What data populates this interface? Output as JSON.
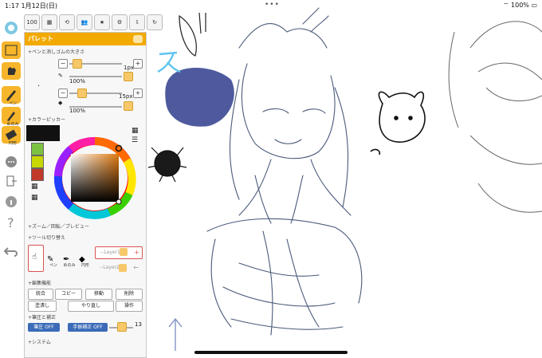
{
  "status_bar": {
    "time": "1:17",
    "date": "1月12日(日)",
    "dots": "•••",
    "battery": "100%"
  },
  "toolbar": {
    "zoom_label": "100",
    "tools": [
      {
        "label": "ペン"
      },
      {
        "label": "めのみ"
      },
      {
        "label": "円形"
      }
    ]
  },
  "palette": {
    "title": "パレット",
    "sections": {
      "pen_size": "+ペンと消しゴムの大きさ",
      "color_picker": "+カラーピッカー",
      "zoom": "+ズーム／回転／プレビュー",
      "tool_switch": "+ツール切り替え",
      "edit": "+編集機能",
      "pressure": "+筆圧と補正",
      "system": "+システム"
    },
    "pen": {
      "size": "1px",
      "opacity": "100%"
    },
    "eraser": {
      "size": "15px",
      "opacity": "100%"
    },
    "color": {
      "current": "#111111",
      "swatches": [
        "#7dc242",
        "#c8d700",
        "#c0392b"
      ]
    },
    "tool_switch": {
      "tools": [
        "ペン",
        "めのみ",
        "円形"
      ],
      "layer1": "--Layer1--",
      "layer2": "--Layer2--"
    },
    "edit_buttons": [
      "統合",
      "コピー",
      "移動",
      "削除",
      "塗潰し",
      "やり直し",
      "操作"
    ],
    "pressure": {
      "pressure_label": "筆圧 OFF",
      "correction_label": "手振補正 OFF",
      "value": "13"
    }
  }
}
